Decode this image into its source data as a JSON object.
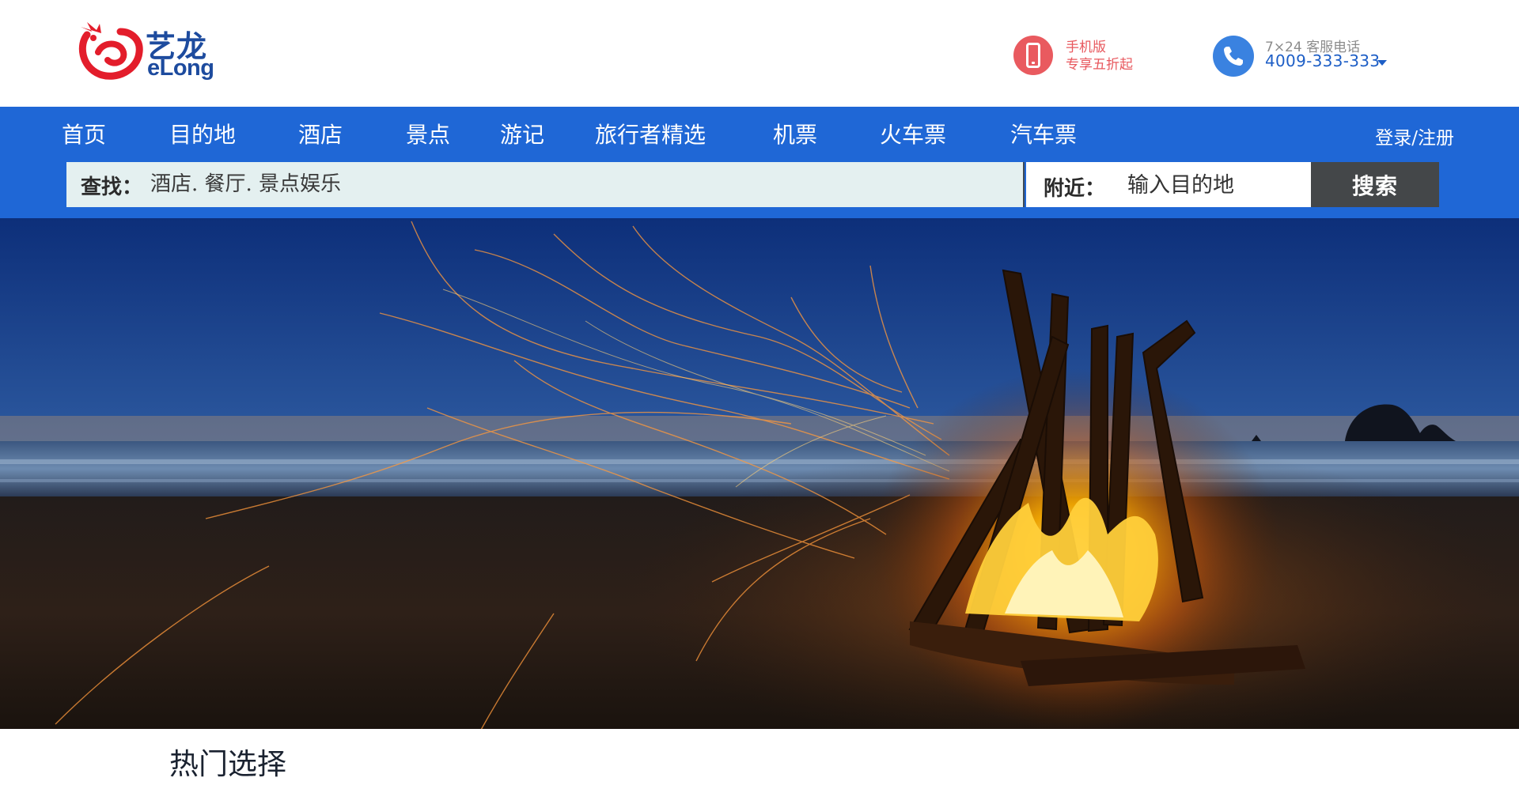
{
  "brand": {
    "name_cn": "艺龙",
    "name_en": "eLong",
    "color": "#1d4b9e",
    "mark_color": "#e31d2b"
  },
  "header": {
    "mobile_promo": {
      "icon": "mobile-phone-icon",
      "line1": "手机版",
      "line2": "专享五折起",
      "color": "#e8585e"
    },
    "service": {
      "icon": "phone-receiver-icon",
      "label": "7×24 客服电话",
      "number": "4009-333-333",
      "color": "#1d5ec6"
    }
  },
  "nav": {
    "items": [
      {
        "label": "首页"
      },
      {
        "label": "目的地"
      },
      {
        "label": "酒店"
      },
      {
        "label": "景点"
      },
      {
        "label": "游记"
      },
      {
        "label": "旅行者精选"
      },
      {
        "label": "机票"
      },
      {
        "label": "火车票"
      },
      {
        "label": "汽车票"
      }
    ],
    "login": "登录/注册",
    "background": "#1f67d6"
  },
  "search": {
    "find_label": "查找：",
    "find_placeholder": "酒店. 餐厅. 景点娱乐",
    "near_label": "附近：",
    "near_placeholder": "输入目的地",
    "button": "搜索"
  },
  "hero": {
    "image": "beach-campfire-at-dusk"
  },
  "sections": {
    "hot_title": "热门选择"
  }
}
